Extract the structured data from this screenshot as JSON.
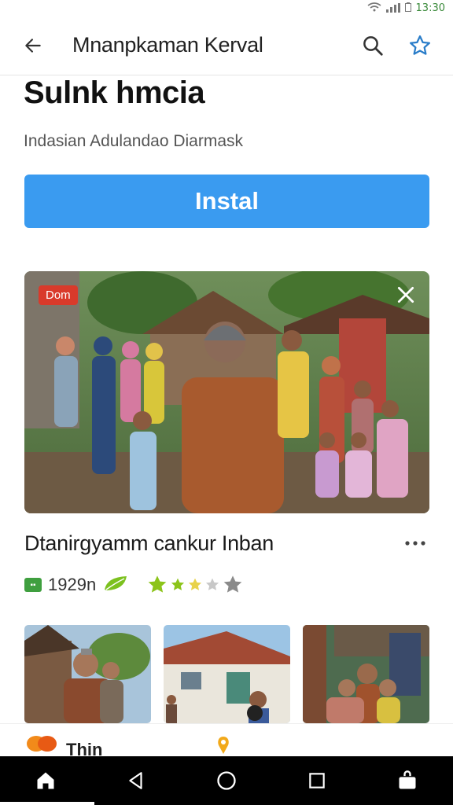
{
  "status_bar": {
    "time": "13:30"
  },
  "app_bar": {
    "back_icon": "arrow-left-icon",
    "title": "Mnanpkaman Kerval",
    "search_icon": "search-icon",
    "favorite_icon": "star-outline-icon"
  },
  "hero": {
    "title": "Sulnk hmcia",
    "subtitle": "Indasian Adulandao Diarmask"
  },
  "install_button": {
    "label": "Instal"
  },
  "featured_media": {
    "badge": "Dom",
    "close_icon": "close-icon"
  },
  "card": {
    "title": "Dtanirgyamm cankur Inban",
    "more_icon": "more-horizontal-icon"
  },
  "meta": {
    "count": "1929n",
    "rating": 2.5,
    "star_count": 5,
    "accent": "#3f9f3f",
    "star_color": "#8cc41a"
  },
  "thumbnails": [
    {
      "name": "thumb-village-men"
    },
    {
      "name": "thumb-house"
    },
    {
      "name": "thumb-family"
    }
  ],
  "bottom_strip": {
    "label": "Thin"
  },
  "nav": {
    "home_icon": "home-icon",
    "back_icon": "triangle-back-icon",
    "circle_icon": "circle-home-icon",
    "recents_icon": "square-recents-icon",
    "bag_icon": "bag-icon"
  },
  "colors": {
    "primary": "#3a9bf0",
    "badge": "#d93a2b"
  }
}
